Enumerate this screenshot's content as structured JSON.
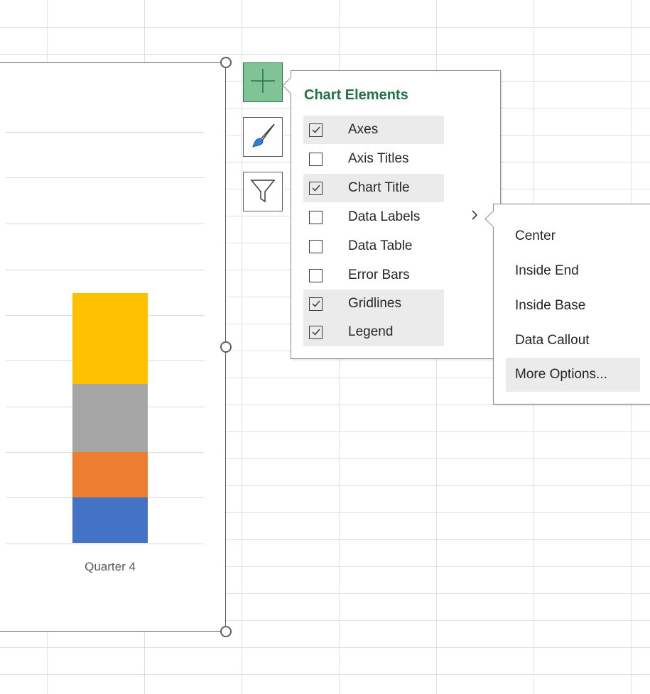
{
  "chart": {
    "category_label": "Quarter 4",
    "segments": [
      {
        "color": "#4472c4"
      },
      {
        "color": "#ed7d31"
      },
      {
        "color": "#a5a5a5"
      },
      {
        "color": "#ffc000"
      }
    ]
  },
  "side_buttons": {
    "add_elements_icon": "plus-icon",
    "styles_icon": "paintbrush-icon",
    "filters_icon": "funnel-icon"
  },
  "chart_elements": {
    "title": "Chart Elements",
    "items": [
      {
        "label": "Axes",
        "checked": true
      },
      {
        "label": "Axis Titles",
        "checked": false
      },
      {
        "label": "Chart Title",
        "checked": true
      },
      {
        "label": "Data Labels",
        "checked": false
      },
      {
        "label": "Data Table",
        "checked": false
      },
      {
        "label": "Error Bars",
        "checked": false
      },
      {
        "label": "Gridlines",
        "checked": true
      },
      {
        "label": "Legend",
        "checked": true
      }
    ],
    "expand_icon": "chevron-right-icon"
  },
  "data_labels_menu": {
    "items": [
      {
        "label": "Center"
      },
      {
        "label": "Inside End"
      },
      {
        "label": "Inside Base"
      },
      {
        "label": "Data Callout"
      },
      {
        "label": "More Options..."
      }
    ]
  },
  "colors": {
    "accent_green": "#217346",
    "active_button": "#7fc397"
  }
}
